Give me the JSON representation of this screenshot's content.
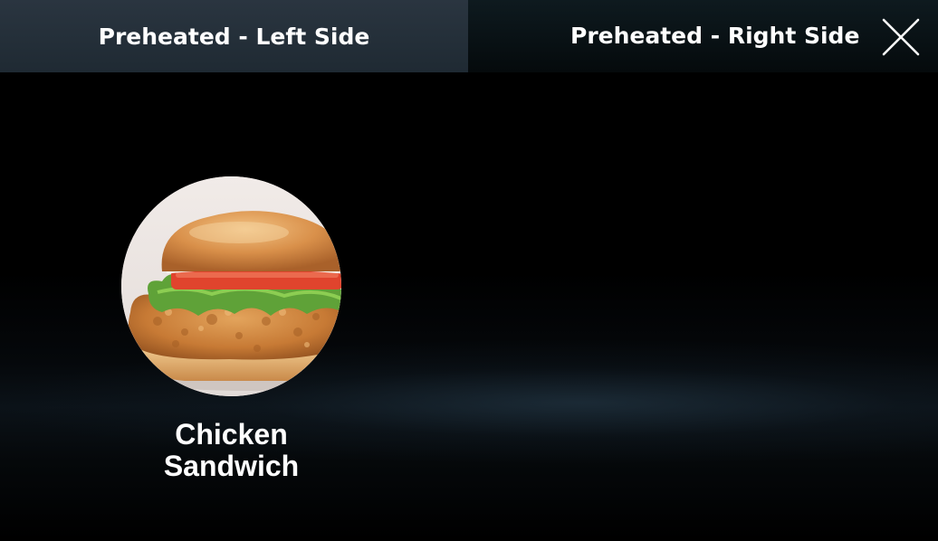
{
  "header": {
    "tabs": [
      {
        "label": "Preheated - Left Side",
        "active": true
      },
      {
        "label": "Preheated - Right Side",
        "active": false
      }
    ],
    "close_icon": "close-icon"
  },
  "menu": {
    "items": [
      {
        "name": "Chicken\nSandwich",
        "image": "chicken-sandwich-photo"
      }
    ]
  },
  "colors": {
    "active_tab": "#26313b",
    "inactive_tab": "#0a1215",
    "background": "#000000",
    "text": "#ffffff"
  }
}
